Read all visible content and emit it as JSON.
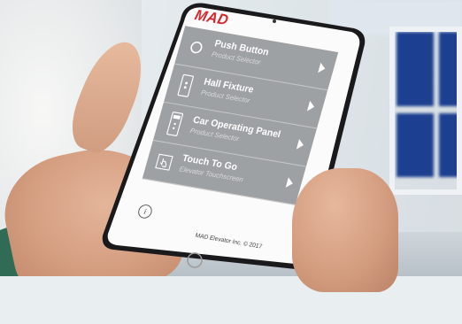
{
  "app": {
    "logo_text": "MAD",
    "brand_color": "#d8262b"
  },
  "menu": {
    "items": [
      {
        "title": "Push Button",
        "subtitle": "Product Selector",
        "icon": "circle-button-icon"
      },
      {
        "title": "Hall Fixture",
        "subtitle": "Product Selector",
        "icon": "hall-fixture-icon"
      },
      {
        "title": "Car Operating Panel",
        "subtitle": "Product Selector",
        "icon": "car-operating-panel-icon"
      },
      {
        "title": "Touch To Go",
        "subtitle": "Elevator Touchscreen",
        "icon": "touch-hand-icon"
      }
    ],
    "row_color": "#9ea1a4",
    "arrow_icon": "chevron-right-icon"
  },
  "footer": {
    "info_icon_glyph": "i",
    "copyright": "MAD Elevator Inc. © 2017"
  }
}
